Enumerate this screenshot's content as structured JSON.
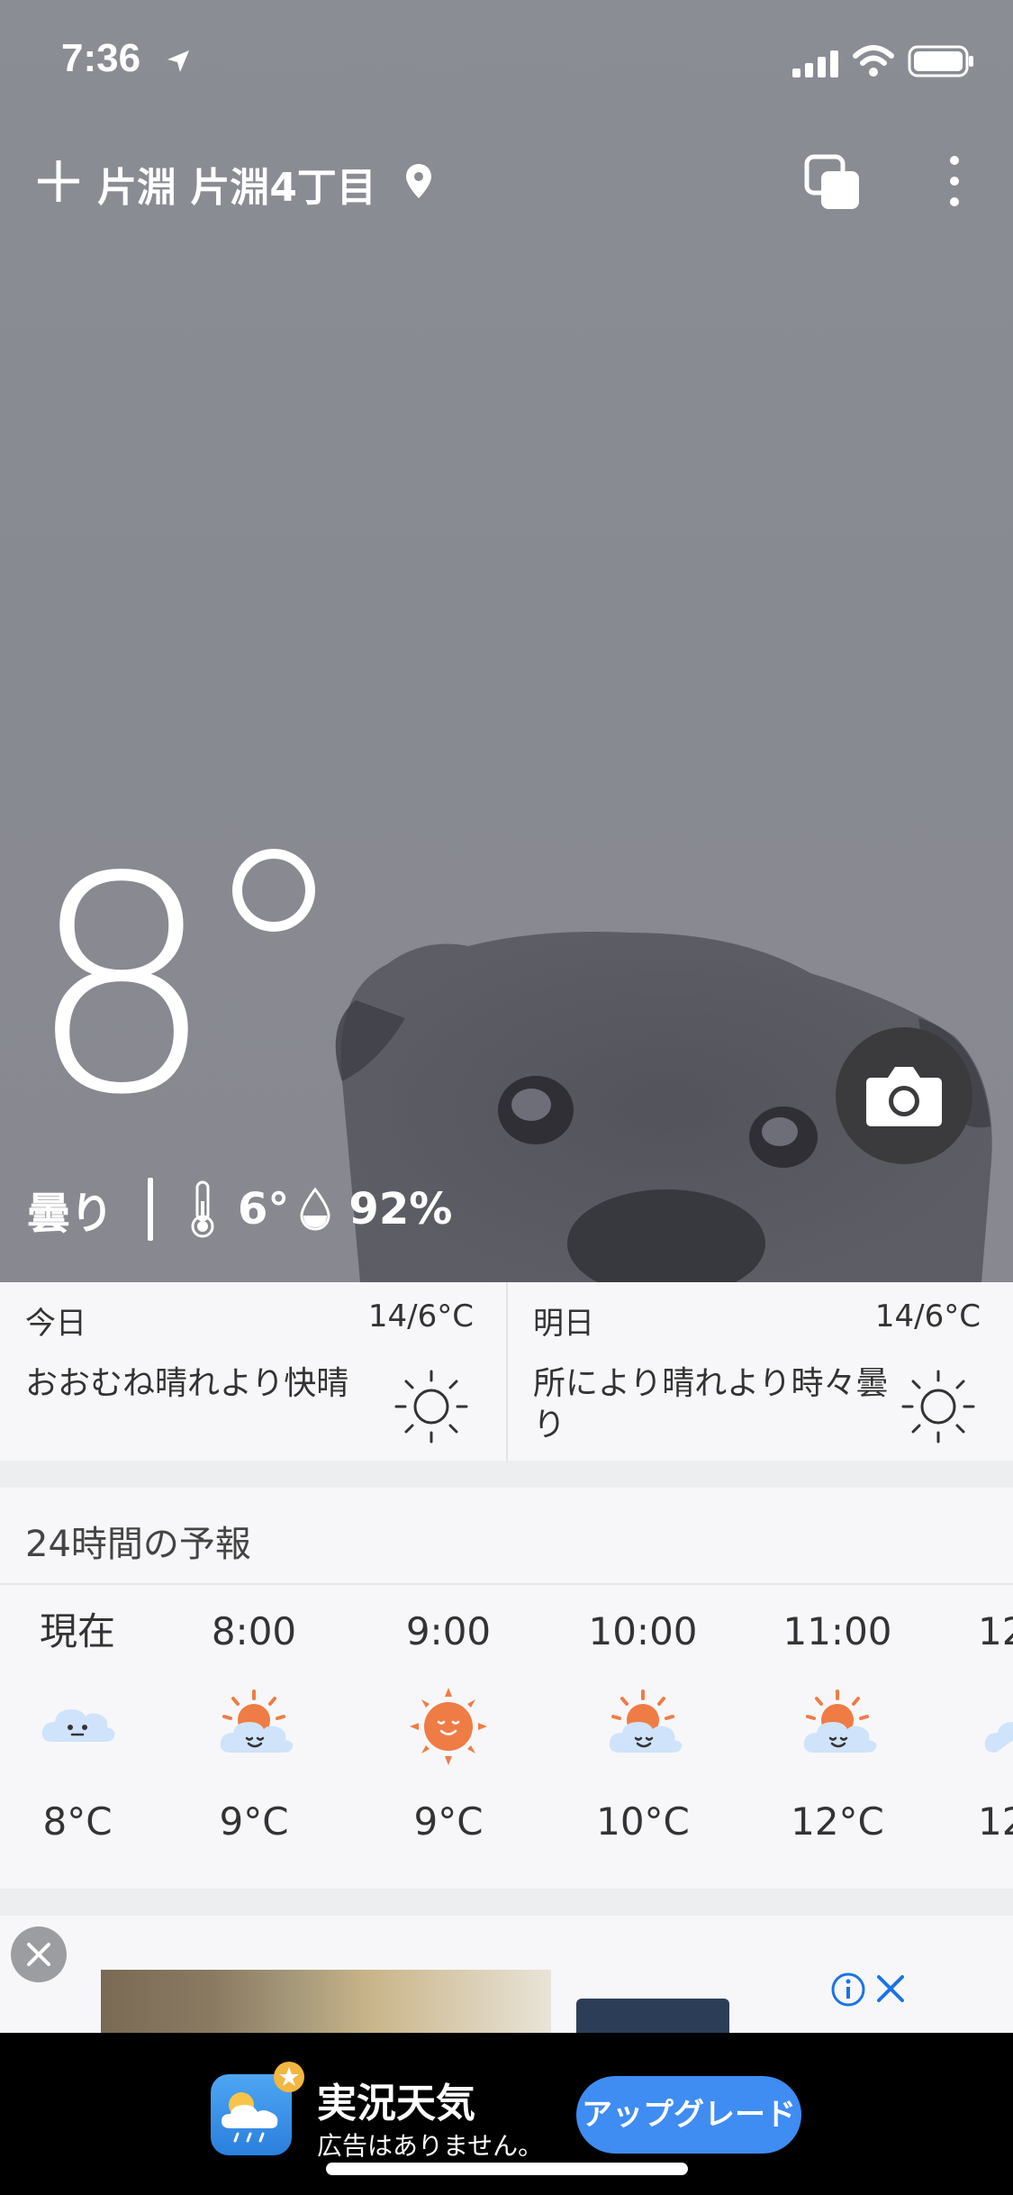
{
  "status_bar": {
    "time": "7:36"
  },
  "header": {
    "location": "片淵 片淵4丁目"
  },
  "current": {
    "temperature": "8",
    "condition": "曇り",
    "feels_like": "6°",
    "humidity": "92%"
  },
  "daily": [
    {
      "label": "今日",
      "temp": "14/6°C",
      "desc": "おおむね晴れより快晴",
      "icon": "sun-icon"
    },
    {
      "label": "明日",
      "temp": "14/6°C",
      "desc": "所により晴れより時々曇り",
      "icon": "sun-icon"
    }
  ],
  "hourly": {
    "title": "24時間の予報",
    "items": [
      {
        "time": "現在",
        "temp": "8°C",
        "icon": "cloud-icon"
      },
      {
        "time": "8:00",
        "temp": "9°C",
        "icon": "partly-sunny-icon"
      },
      {
        "time": "9:00",
        "temp": "9°C",
        "icon": "sun-icon"
      },
      {
        "time": "10:00",
        "temp": "10°C",
        "icon": "partly-sunny-icon"
      },
      {
        "time": "11:00",
        "temp": "12°C",
        "icon": "partly-sunny-icon"
      },
      {
        "time": "12",
        "temp": "12",
        "icon": "partly-sunny-icon"
      }
    ]
  },
  "promo": {
    "title": "実況天気",
    "subtitle": "広告はありません。",
    "button": "アップグレード"
  },
  "colors": {
    "hero_bg": "#898b93",
    "accent_blue": "#3f8cf2",
    "sun_orange": "#ef7c45",
    "cloud_blue": "#cfe3fa"
  }
}
